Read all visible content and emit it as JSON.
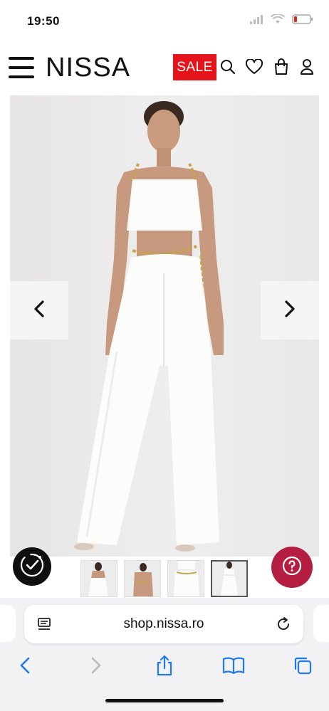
{
  "status_bar": {
    "time": "19:50"
  },
  "header": {
    "logo": "NISSA",
    "sale_label": "SALE"
  },
  "gallery": {
    "thumbnail_count": 4,
    "active_thumbnail": 4
  },
  "browser": {
    "url": "shop.nissa.ro"
  },
  "colors": {
    "sale_red": "#e5141b",
    "help_crimson": "#b51d41",
    "ios_blue": "#1f7aea"
  },
  "icons": {
    "header": [
      "menu-icon",
      "search-icon",
      "heart-icon",
      "bag-icon",
      "user-icon"
    ],
    "gallery": [
      "chevron-left-icon",
      "chevron-right-icon",
      "trust-badge-icon",
      "help-icon"
    ],
    "browser": [
      "reader-icon",
      "reload-icon",
      "back-icon",
      "forward-icon",
      "share-icon",
      "bookmarks-icon",
      "tabs-icon"
    ]
  }
}
